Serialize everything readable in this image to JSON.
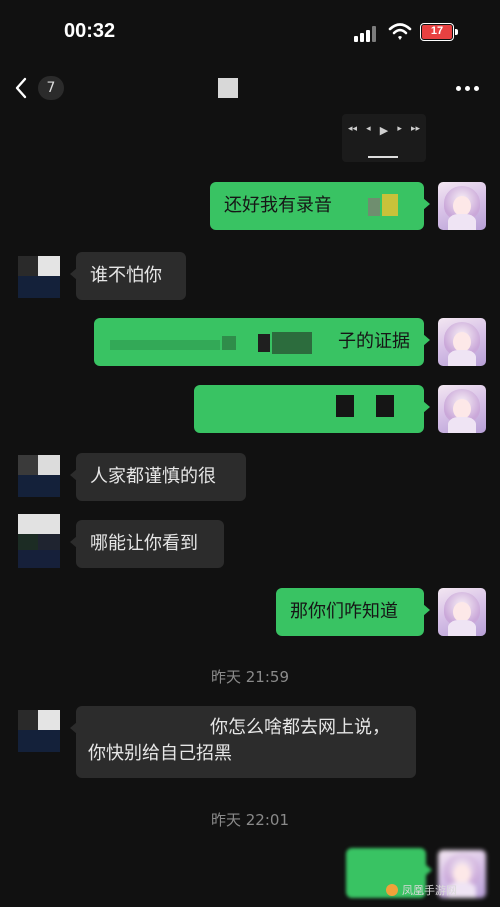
{
  "status_bar": {
    "time": "00:32",
    "battery_level": "17",
    "signal_icon": "cellular-signal-icon",
    "wifi_icon": "wifi-icon"
  },
  "nav": {
    "back_icon": "chevron-left-icon",
    "unread_count": "7",
    "more_icon": "more-dots-icon"
  },
  "messages": [
    {
      "side": "out",
      "text": "还好我有录音"
    },
    {
      "side": "in",
      "text": "谁不怕你"
    },
    {
      "side": "out",
      "text": "子的证据"
    },
    {
      "side": "out",
      "text": ""
    },
    {
      "side": "in",
      "text": "人家都谨慎的很"
    },
    {
      "side": "in",
      "text": "哪能让你看到"
    },
    {
      "side": "out",
      "text": "那你们咋知道"
    },
    {
      "side": "in",
      "text": "你怎么啥都去网上说，你快别给自己招黑"
    }
  ],
  "timestamps": [
    "昨天 21:59",
    "昨天 22:01"
  ],
  "watermark": "凤凰手游网",
  "colors": {
    "background": "#111111",
    "outgoing_bubble": "#39c363",
    "incoming_bubble": "#2c2c2c",
    "battery_low": "#e84141"
  }
}
